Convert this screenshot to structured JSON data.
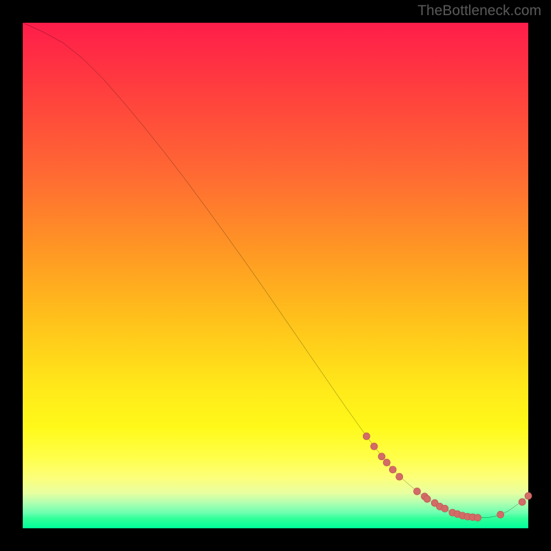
{
  "attribution": "TheBottleneck.com",
  "colors": {
    "page_bg": "#000000",
    "gradient_top": "#ff1d4a",
    "gradient_mid": "#ffe81a",
    "gradient_bottom": "#00ff99",
    "curve": "#000000",
    "marker_fill": "#d36b67",
    "marker_stroke": "#c05a55"
  },
  "chart_data": {
    "type": "line",
    "title": "",
    "xlabel": "",
    "ylabel": "",
    "xlim": [
      0,
      100
    ],
    "ylim": [
      0,
      100
    ],
    "grid": false,
    "series": [
      {
        "name": "bottleneck-curve",
        "x": [
          0,
          4,
          8,
          12,
          16,
          20,
          24,
          28,
          32,
          36,
          40,
          44,
          48,
          52,
          56,
          60,
          64,
          68,
          72,
          74,
          76,
          78,
          80,
          82,
          84,
          86,
          88,
          90,
          92,
          94,
          96,
          98,
          100
        ],
        "y": [
          100,
          98.2,
          96.0,
          92.8,
          88.8,
          84.2,
          79.4,
          74.4,
          69.2,
          63.8,
          58.3,
          52.7,
          47.0,
          41.2,
          35.4,
          29.6,
          23.8,
          18.2,
          13.0,
          10.8,
          9.0,
          7.3,
          5.8,
          4.5,
          3.5,
          2.8,
          2.3,
          2.1,
          2.1,
          2.5,
          3.4,
          4.8,
          6.4
        ]
      }
    ],
    "markers": [
      {
        "x": 68.0,
        "y": 18.2
      },
      {
        "x": 69.5,
        "y": 16.2
      },
      {
        "x": 71.0,
        "y": 14.2
      },
      {
        "x": 72.0,
        "y": 13.0
      },
      {
        "x": 73.2,
        "y": 11.6
      },
      {
        "x": 74.5,
        "y": 10.2
      },
      {
        "x": 78.0,
        "y": 7.3
      },
      {
        "x": 79.5,
        "y": 6.3
      },
      {
        "x": 80.0,
        "y": 5.8
      },
      {
        "x": 81.5,
        "y": 5.0
      },
      {
        "x": 82.5,
        "y": 4.3
      },
      {
        "x": 83.5,
        "y": 3.9
      },
      {
        "x": 85.0,
        "y": 3.1
      },
      {
        "x": 86.0,
        "y": 2.8
      },
      {
        "x": 87.0,
        "y": 2.5
      },
      {
        "x": 88.0,
        "y": 2.3
      },
      {
        "x": 89.0,
        "y": 2.2
      },
      {
        "x": 90.0,
        "y": 2.1
      },
      {
        "x": 94.5,
        "y": 2.7
      },
      {
        "x": 98.8,
        "y": 5.2
      },
      {
        "x": 100.0,
        "y": 6.4
      }
    ]
  }
}
